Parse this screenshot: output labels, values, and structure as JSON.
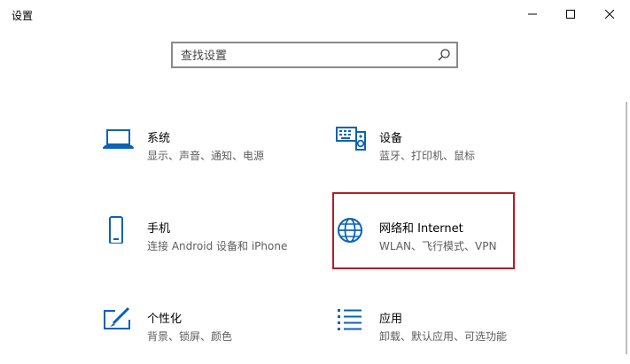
{
  "window": {
    "title": "设置",
    "controls": {
      "minimize": "minimize",
      "maximize": "maximize",
      "close": "close"
    }
  },
  "search": {
    "placeholder": "查找设置",
    "value": ""
  },
  "tiles": [
    {
      "key": "system",
      "name": "系统",
      "desc": "显示、声音、通知、电源",
      "icon": "laptop-icon"
    },
    {
      "key": "devices",
      "name": "设备",
      "desc": "蓝牙、打印机、鼠标",
      "icon": "keyboard-speaker-icon"
    },
    {
      "key": "phone",
      "name": "手机",
      "desc": "连接 Android 设备和 iPhone",
      "icon": "phone-icon"
    },
    {
      "key": "network",
      "name": "网络和 Internet",
      "desc": "WLAN、飞行模式、VPN",
      "icon": "globe-icon",
      "selected": true
    },
    {
      "key": "personal",
      "name": "个性化",
      "desc": "背景、锁屏、颜色",
      "icon": "paint-tablet-icon"
    },
    {
      "key": "apps",
      "name": "应用",
      "desc": "卸载、默认应用、可选功能",
      "icon": "apps-list-icon"
    }
  ],
  "colors": {
    "accent": "#0078d7",
    "highlight_border": "#b81c22"
  }
}
